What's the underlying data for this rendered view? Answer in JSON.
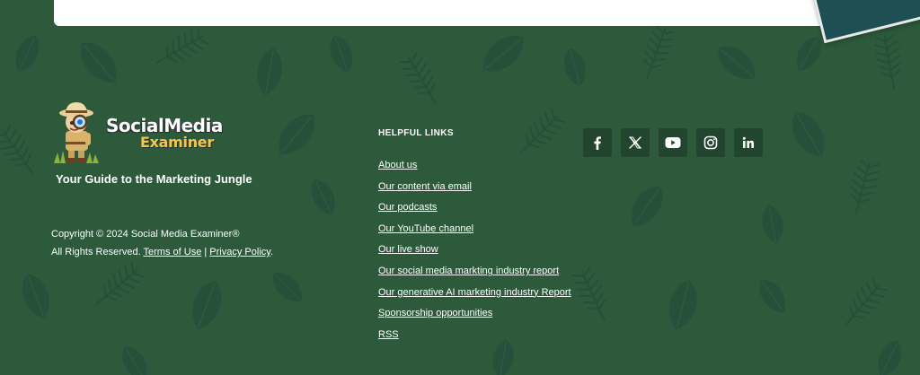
{
  "brand": {
    "logo_line1": "SocialMedia",
    "logo_line2": "Examiner",
    "tagline": "Your Guide to the Marketing Jungle"
  },
  "copyright": {
    "line1": "Copyright © 2024 Social Media Examiner®",
    "rights": "All Rights Reserved.",
    "terms_label": "Terms of Use",
    "separator": "|",
    "privacy_label": "Privacy Policy",
    "end": "."
  },
  "helpful_links": {
    "title": "HELPFUL LINKS",
    "items": [
      {
        "label": "About us"
      },
      {
        "label": "Our content via email"
      },
      {
        "label": "Our podcasts"
      },
      {
        "label": "Our YouTube channel"
      },
      {
        "label": "Our live show"
      },
      {
        "label": "Our social media markting industry report"
      },
      {
        "label": "Our generative AI marketing industry Report"
      },
      {
        "label": "Sponsorship opportunities"
      },
      {
        "label": "RSS"
      }
    ]
  },
  "social": {
    "icons": [
      "facebook-icon",
      "x-icon",
      "youtube-icon",
      "instagram-icon",
      "linkedin-icon"
    ]
  },
  "colors": {
    "background": "#2c5a3a",
    "social_button": "#22452d",
    "logo_accent": "#f2c84b",
    "badge": "#1e4f52"
  }
}
